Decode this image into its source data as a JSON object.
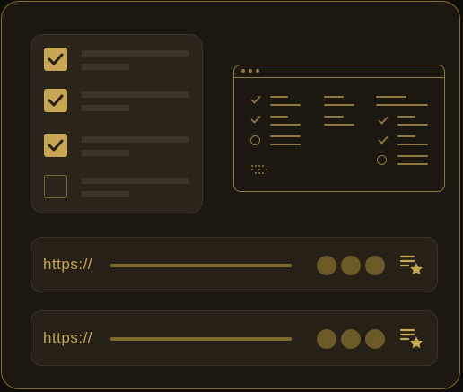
{
  "checklist": {
    "items": [
      {
        "checked": true
      },
      {
        "checked": true
      },
      {
        "checked": true
      },
      {
        "checked": false
      }
    ]
  },
  "browser_wireframe": {
    "columns": 3
  },
  "url_bars": [
    {
      "text": "https://"
    },
    {
      "text": "https://"
    }
  ],
  "colors": {
    "accent": "#c7a753",
    "frame_border": "#8a6f22",
    "background": "#1c1710",
    "panel": "#2a241b",
    "wire": "#8e7a3f"
  },
  "icons": [
    "check-icon",
    "bookmark-star-icon",
    "more-dots-icon"
  ]
}
